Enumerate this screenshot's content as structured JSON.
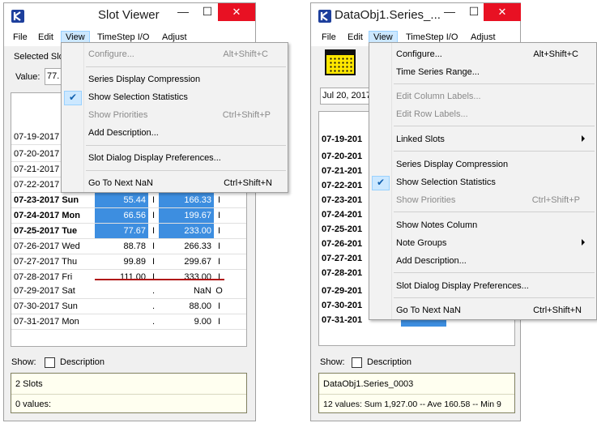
{
  "left_window": {
    "title": "Slot Viewer",
    "menu": [
      "File",
      "Edit",
      "View",
      "TimeStep I/O",
      "Adjust"
    ],
    "selected_label": "Selected Slo",
    "value_label": "Value:",
    "value_input": "77.",
    "rows_top": [
      {
        "date": "07-19-2017"
      },
      {
        "date": "07-20-2017"
      },
      {
        "date": "07-21-2017"
      },
      {
        "date": "07-22-2017"
      }
    ],
    "rows_bottom": [
      {
        "date": "07-23-2017 Sun",
        "v1": "55.44",
        "f1": "I",
        "v2": "166.33",
        "f2": "I",
        "bold": true,
        "selected": true
      },
      {
        "date": "07-24-2017 Mon",
        "v1": "66.56",
        "f1": "I",
        "v2": "199.67",
        "f2": "I",
        "bold": true,
        "selected": true
      },
      {
        "date": "07-25-2017 Tue",
        "v1": "77.67",
        "f1": "I",
        "v2": "233.00",
        "f2": "I",
        "bold": true,
        "selected": true
      },
      {
        "date": "07-26-2017 Wed",
        "v1": "88.78",
        "f1": "I",
        "v2": "266.33",
        "f2": "I",
        "bold": false,
        "selected": false
      },
      {
        "date": "07-27-2017 Thu",
        "v1": "99.89",
        "f1": "I",
        "v2": "299.67",
        "f2": "I",
        "bold": false,
        "selected": false
      },
      {
        "date": "07-28-2017 Fri",
        "v1": "111.00",
        "f1": "I",
        "v2": "333.00",
        "f2": "I",
        "bold": false,
        "selected": false
      },
      {
        "date": "07-29-2017 Sat",
        "v1": "",
        "f1": ".",
        "v2": "NaN",
        "f2": "O",
        "bold": false,
        "selected": false
      },
      {
        "date": "07-30-2017 Sun",
        "v1": "",
        "f1": ".",
        "v2": "88.00",
        "f2": "I",
        "bold": false,
        "selected": false
      },
      {
        "date": "07-31-2017 Mon",
        "v1": "",
        "f1": ".",
        "v2": "9.00",
        "f2": "I",
        "bold": false,
        "selected": false
      }
    ],
    "show_label": "Show:",
    "description_label": "Description",
    "status_line1": "2 Slots",
    "status_line2": "0 values:",
    "view_menu": [
      {
        "label": "Configure...",
        "shortcut": "Alt+Shift+C",
        "disabled": true
      },
      {
        "label": "Series Display Compression",
        "shortcut": "",
        "disabled": false
      },
      {
        "label": "Show Selection Statistics",
        "shortcut": "",
        "disabled": false,
        "checked": true
      },
      {
        "label": "Show Priorities",
        "shortcut": "Ctrl+Shift+P",
        "disabled": true
      },
      {
        "label": "Add Description...",
        "shortcut": "",
        "disabled": false
      },
      {
        "label": "Slot Dialog Display Preferences...",
        "shortcut": "",
        "disabled": false
      },
      {
        "label": "Go To Next NaN",
        "shortcut": "Ctrl+Shift+N",
        "disabled": false
      }
    ]
  },
  "right_window": {
    "title": "DataObj1.Series_...",
    "menu": [
      "File",
      "Edit",
      "View",
      "TimeStep I/O",
      "Adjust"
    ],
    "date_input": "Jul 20, 2017",
    "dates": [
      "07-19-201",
      "07-20-201",
      "07-21-201",
      "07-22-201",
      "07-23-201",
      "07-24-201",
      "07-25-201",
      "07-26-201",
      "07-27-201",
      "07-28-201",
      "07-29-201",
      "07-30-201",
      "07-31-201"
    ],
    "show_label": "Show:",
    "description_label": "Description",
    "status_line1": "DataObj1.Series_0003",
    "status_line2": "12 values:  Sum 1,927.00 -- Ave 160.58 -- Min 9",
    "view_menu": [
      {
        "label": "Configure...",
        "shortcut": "Alt+Shift+C",
        "disabled": false
      },
      {
        "label": "Time Series Range...",
        "shortcut": "",
        "disabled": false
      },
      {
        "label": "Edit Column Labels...",
        "shortcut": "",
        "disabled": true
      },
      {
        "label": "Edit Row Labels...",
        "shortcut": "",
        "disabled": true
      },
      {
        "label": "Linked Slots",
        "shortcut": "",
        "disabled": false,
        "submenu": true
      },
      {
        "label": "Series Display Compression",
        "shortcut": "",
        "disabled": false
      },
      {
        "label": "Show Selection Statistics",
        "shortcut": "",
        "disabled": false,
        "checked": true
      },
      {
        "label": "Show Priorities",
        "shortcut": "Ctrl+Shift+P",
        "disabled": true
      },
      {
        "label": "Show Notes Column",
        "shortcut": "",
        "disabled": false
      },
      {
        "label": "Note Groups",
        "shortcut": "",
        "disabled": false,
        "submenu": true
      },
      {
        "label": "Add Description...",
        "shortcut": "",
        "disabled": false
      },
      {
        "label": "Slot Dialog Display Preferences...",
        "shortcut": "",
        "disabled": false
      },
      {
        "label": "Go To Next NaN",
        "shortcut": "Ctrl+Shift+N",
        "disabled": false
      }
    ]
  },
  "icons": {
    "minimize": "—",
    "maximize": "☐",
    "close": "✕",
    "check": "✔",
    "app": "riverware-logo-icon",
    "calendar": "calendar-grid-icon"
  }
}
